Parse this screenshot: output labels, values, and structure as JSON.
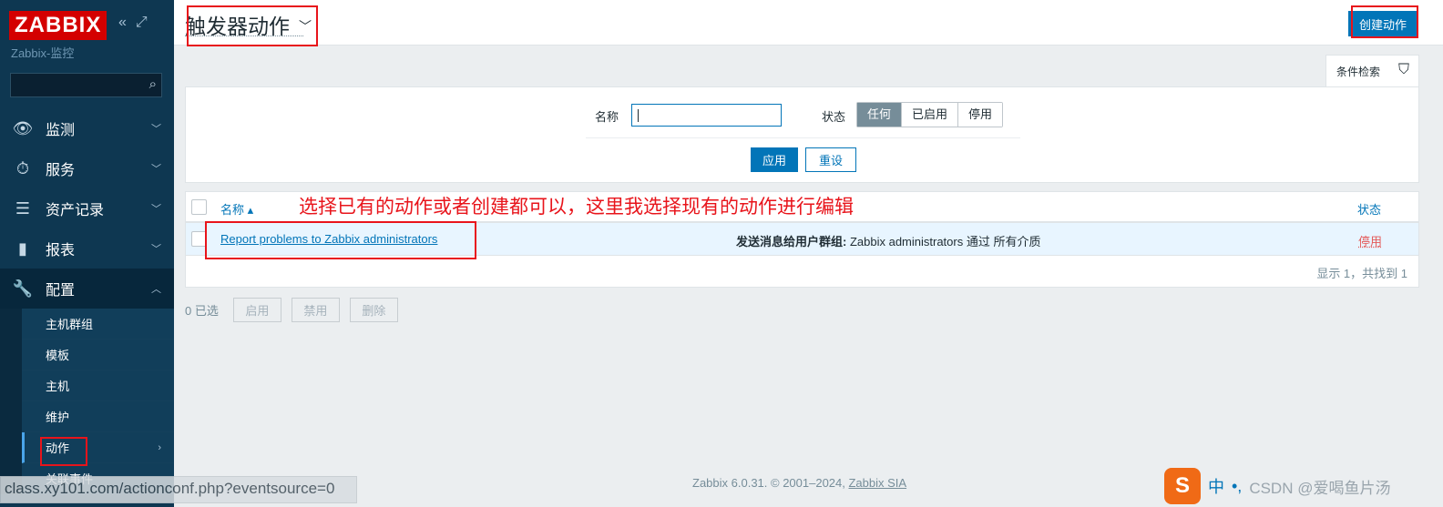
{
  "sidebar": {
    "logo": "ZABBIX",
    "server_name": "Zabbix-监控",
    "search_placeholder": "",
    "menu": [
      {
        "label": "监测",
        "icon": "eye-icon",
        "glyph": "👁"
      },
      {
        "label": "服务",
        "icon": "stopwatch-icon",
        "glyph": "⏱"
      },
      {
        "label": "资产记录",
        "icon": "list-icon",
        "glyph": "☰"
      },
      {
        "label": "报表",
        "icon": "bar-chart-icon",
        "glyph": "▮"
      },
      {
        "label": "配置",
        "icon": "wrench-icon",
        "glyph": "🔧"
      }
    ],
    "submenu": [
      "主机群组",
      "模板",
      "主机",
      "维护",
      "动作",
      "关联事件"
    ]
  },
  "header": {
    "title": "触发器动作",
    "create_label": "创建动作"
  },
  "filter": {
    "tab_label": "条件检索",
    "name_label": "名称",
    "name_value": "",
    "status_label": "状态",
    "status_options": [
      "任何",
      "已启用",
      "停用"
    ],
    "status_selected": "任何",
    "apply_label": "应用",
    "reset_label": "重设"
  },
  "table": {
    "col_name": "名称 ▴",
    "col_status": "状态",
    "annotation": "选择已有的动作或者创建都可以，这里我选择现有的动作进行编辑",
    "rows": [
      {
        "name": "Report problems to Zabbix administrators",
        "operations_bold": "发送消息给用户群组:",
        "operations_rest": " Zabbix administrators 通过 所有介质",
        "status": "停用"
      }
    ],
    "found": "显示 1，共找到 1"
  },
  "bulk": {
    "selected": "0 已选",
    "enable": "启用",
    "disable": "禁用",
    "delete": "删除"
  },
  "footer": {
    "text": "Zabbix 6.0.31. © 2001–2024, ",
    "link": "Zabbix SIA"
  },
  "statusbar": "class.xy101.com/actionconf.php?eventsource=0",
  "ime": {
    "logo": "S",
    "lang": "中",
    "punct": "•,",
    "watermark": "CSDN @爱喝鱼片汤"
  },
  "colors": {
    "sidebar": "#0e3751",
    "accent": "#0275b8",
    "logo_red": "#d40000",
    "annotation_red": "#e8141b",
    "disabled_red": "#e45959"
  }
}
